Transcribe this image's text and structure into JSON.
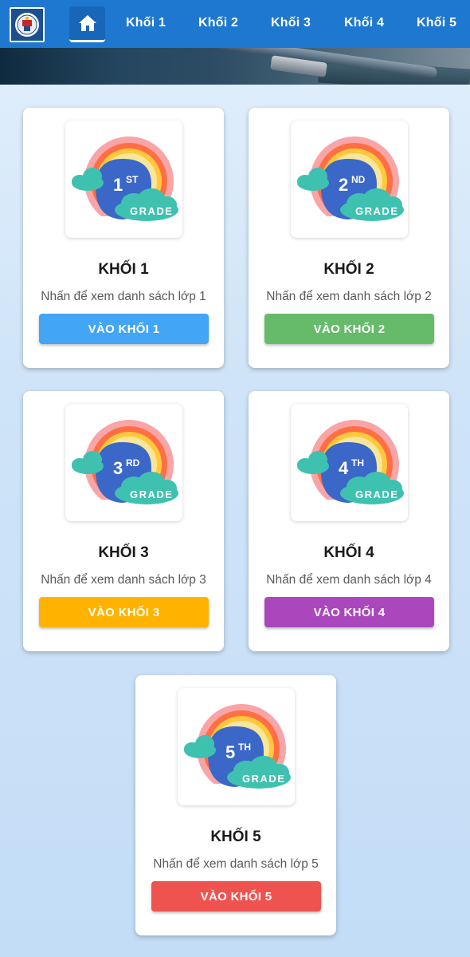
{
  "nav": {
    "home_icon": "home-icon",
    "logo_icon": "school-logo",
    "items": [
      "Khối 1",
      "Khối 2",
      "Khối 3",
      "Khối 4",
      "Khối 5"
    ]
  },
  "grades": [
    {
      "title": "KHỐI 1",
      "desc": "Nhấn để xem danh sách lớp 1",
      "button": "VÀO KHỐI 1",
      "badge_num": "1",
      "badge_suffix": "ST",
      "badge_word": "GRADE",
      "color": "#42a5f5"
    },
    {
      "title": "KHỐI 2",
      "desc": "Nhấn để xem danh sách lớp 2",
      "button": "VÀO KHỐI 2",
      "badge_num": "2",
      "badge_suffix": "ND",
      "badge_word": "GRADE",
      "color": "#66bb6a"
    },
    {
      "title": "KHỐI 3",
      "desc": "Nhấn để xem danh sách lớp 3",
      "button": "VÀO KHỐI 3",
      "badge_num": "3",
      "badge_suffix": "RD",
      "badge_word": "GRADE",
      "color": "#ffb300"
    },
    {
      "title": "KHỐI 4",
      "desc": "Nhấn để xem danh sách lớp 4",
      "button": "VÀO KHỐI 4",
      "badge_num": "4",
      "badge_suffix": "TH",
      "badge_word": "GRADE",
      "color": "#ab47bc"
    },
    {
      "title": "KHỐI 5",
      "desc": "Nhấn để xem danh sách lớp 5",
      "button": "VÀO KHỐI 5",
      "badge_num": "5",
      "badge_suffix": "TH",
      "badge_word": "GRADE",
      "color": "#ef5350"
    }
  ],
  "colors": {
    "topbar": "#1e78d0",
    "rainbow": [
      "#f8a5a8",
      "#ff6f43",
      "#ffc83d",
      "#f8e79a"
    ],
    "badge_blue": "#3a67c8",
    "cloud": "#3fc1b0"
  }
}
